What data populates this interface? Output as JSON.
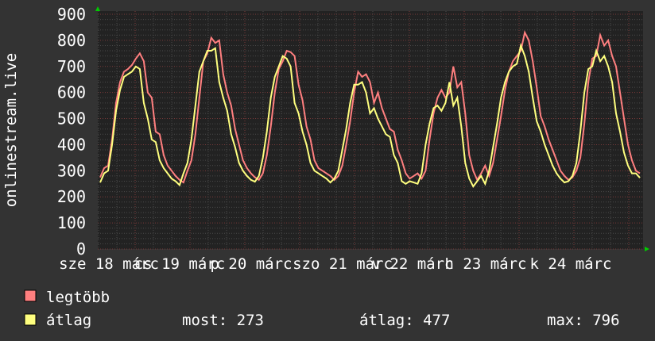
{
  "chart_data": {
    "type": "line",
    "ylabel": "onlinestream.live",
    "ylim": [
      0,
      900
    ],
    "y_ticks": [
      "0",
      "100",
      "200",
      "300",
      "400",
      "500",
      "600",
      "700",
      "800",
      "900"
    ],
    "x_tick_labels": [
      "sze 18 márc",
      "cs 19 márc",
      "p 20 márc",
      "szo 21 márc",
      "v 22 márc",
      "h 23 márc",
      "k 24 márc"
    ],
    "grid": true,
    "legend_placement": "bottom-left",
    "background": "#333333",
    "plot_background": "#222222",
    "series": [
      {
        "name": "legtöbb",
        "color": "#ff7f7f",
        "values": [
          275,
          310,
          320,
          420,
          560,
          640,
          680,
          690,
          705,
          730,
          750,
          720,
          600,
          580,
          450,
          440,
          360,
          320,
          300,
          280,
          265,
          255,
          300,
          340,
          440,
          580,
          720,
          750,
          810,
          790,
          800,
          670,
          600,
          550,
          460,
          400,
          340,
          310,
          290,
          275,
          265,
          290,
          360,
          470,
          600,
          690,
          720,
          760,
          755,
          740,
          630,
          570,
          470,
          420,
          340,
          310,
          300,
          290,
          280,
          265,
          280,
          320,
          400,
          490,
          600,
          680,
          660,
          670,
          640,
          560,
          600,
          540,
          500,
          460,
          450,
          380,
          340,
          290,
          270,
          280,
          290,
          270,
          300,
          420,
          520,
          580,
          610,
          580,
          600,
          700,
          620,
          640,
          520,
          360,
          300,
          265,
          290,
          320,
          280,
          330,
          420,
          510,
          610,
          680,
          720,
          740,
          760,
          830,
          800,
          720,
          620,
          510,
          470,
          420,
          380,
          340,
          300,
          280,
          265,
          275,
          300,
          350,
          480,
          640,
          730,
          740,
          820,
          780,
          800,
          740,
          700,
          600,
          500,
          400,
          340,
          300,
          290
        ]
      },
      {
        "name": "átlag",
        "color": "#ffff7f",
        "values": [
          255,
          290,
          300,
          400,
          530,
          610,
          660,
          670,
          680,
          700,
          690,
          560,
          500,
          420,
          410,
          340,
          310,
          290,
          270,
          260,
          245,
          290,
          330,
          420,
          550,
          680,
          720,
          760,
          760,
          770,
          640,
          580,
          530,
          440,
          390,
          330,
          300,
          280,
          265,
          258,
          280,
          350,
          450,
          580,
          660,
          700,
          740,
          730,
          700,
          560,
          520,
          450,
          400,
          330,
          300,
          290,
          280,
          270,
          255,
          270,
          300,
          380,
          460,
          560,
          630,
          630,
          640,
          600,
          520,
          540,
          500,
          470,
          440,
          430,
          360,
          330,
          260,
          250,
          260,
          255,
          250,
          290,
          400,
          480,
          540,
          550,
          530,
          560,
          640,
          550,
          580,
          470,
          330,
          270,
          240,
          260,
          280,
          250,
          300,
          390,
          480,
          580,
          640,
          680,
          700,
          710,
          780,
          740,
          680,
          580,
          490,
          450,
          400,
          360,
          320,
          290,
          270,
          255,
          260,
          280,
          330,
          450,
          600,
          690,
          700,
          760,
          720,
          740,
          700,
          640,
          520,
          450,
          370,
          320,
          290,
          290,
          273
        ]
      }
    ]
  },
  "legend": {
    "max_label": "legtöbb",
    "avg_label": "átlag",
    "current": "most: 273",
    "average": "átlag: 477",
    "maximum": "max: 796"
  }
}
